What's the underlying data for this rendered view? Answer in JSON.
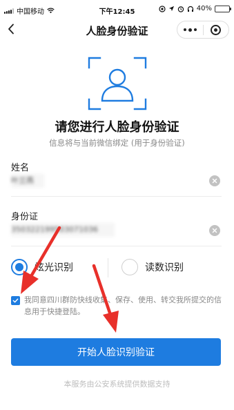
{
  "status_bar": {
    "carrier": "中国移动",
    "time": "下午12:45",
    "battery_percent": "40%",
    "battery_level": 0.4
  },
  "nav": {
    "title": "人脸身份验证",
    "back_icon": "chevron-left-icon",
    "more_icon": "more-dots-icon",
    "close_icon": "target-circle-icon"
  },
  "main": {
    "face_icon": "face-scan-icon",
    "heading": "请您进行人脸身份验证",
    "subheading": "信息将与当前微信绑定 (用于身份验证)"
  },
  "form": {
    "name_label": "姓名",
    "name_value": "叶兰燕",
    "id_label": "身份证",
    "id_value": "350322199503071036"
  },
  "method": {
    "options": [
      {
        "label": "炫光识别",
        "selected": true
      },
      {
        "label": "读数识别",
        "selected": false
      }
    ]
  },
  "agreement": {
    "checked": true,
    "text": "我同意四川群防快线收集、保存、使用、转交我所提交的信息用于快捷登陆。"
  },
  "actions": {
    "start_button": "开始人脸识别验证"
  },
  "footer": {
    "text": "本服务由公安系统提供数据支持"
  },
  "colors": {
    "accent": "#1e7ce0",
    "annotation_arrow": "#e8302a"
  }
}
